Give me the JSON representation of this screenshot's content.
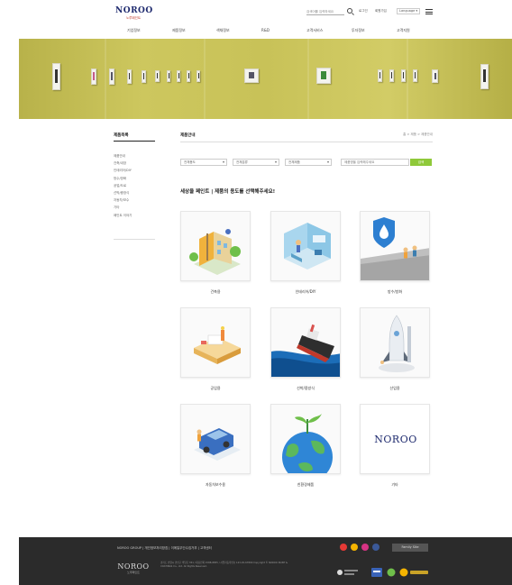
{
  "header": {
    "logo_main": "NOROO",
    "logo_sub": "노루페인트",
    "search_placeholder": "검색어를 입력하세요",
    "util_links": [
      "로그인",
      "회원가입"
    ],
    "language": "Language ▾",
    "gnb": [
      "기업정보",
      "제품정보",
      "색채정보",
      "R&D",
      "고객서비스",
      "투자정보",
      "고객지원"
    ]
  },
  "sidebar": {
    "title": "제품목록",
    "items": [
      "제품안내",
      "건축/내장",
      "인테리어/DIY",
      "방수/방화",
      "공업/도료",
      "선박/중방식",
      "자동차/보수",
      "기타",
      "페인트 이야기"
    ]
  },
  "content": {
    "page_title": "제품안내",
    "breadcrumb": "홈 > 제품 > 제품안내",
    "filters": [
      "전체용도",
      "전체분류",
      "전체제품"
    ],
    "filter_placeholder": "제품명을 입력해주세요",
    "filter_button": "검색",
    "headline": "세상을 페인트 | 제품의 용도를 선택해주세요!",
    "categories": [
      {
        "label": "건축용"
      },
      {
        "label": "인테리어/DIY"
      },
      {
        "label": "방수/방화"
      },
      {
        "label": "공업용"
      },
      {
        "label": "선박/중방식"
      },
      {
        "label": "산업용"
      },
      {
        "label": "자동차보수용"
      },
      {
        "label": "친환경제품"
      },
      {
        "label": "기타",
        "brand": "NOROO"
      }
    ]
  },
  "footer": {
    "links": "NOROO GROUP | 개인정보처리방침 | 이메일무단수집거부 | 고객센터",
    "logo_main": "NOROO",
    "logo_sub": "노루페인트",
    "address": "경기도 안양시 만안구 박달로 351 / 대표전화 1588-8855 / 사업자등록번호 123-45-67890 Copyright © NOROO PAINT & COATINGS Co., Ltd. All Rights Reserved.",
    "family_site": "Family Site"
  },
  "colors": {
    "brand_navy": "#1e2a6e",
    "accent_green": "#8fc93a",
    "banner_olive": "#c8c258",
    "footer_bg": "#2b2b2b"
  }
}
